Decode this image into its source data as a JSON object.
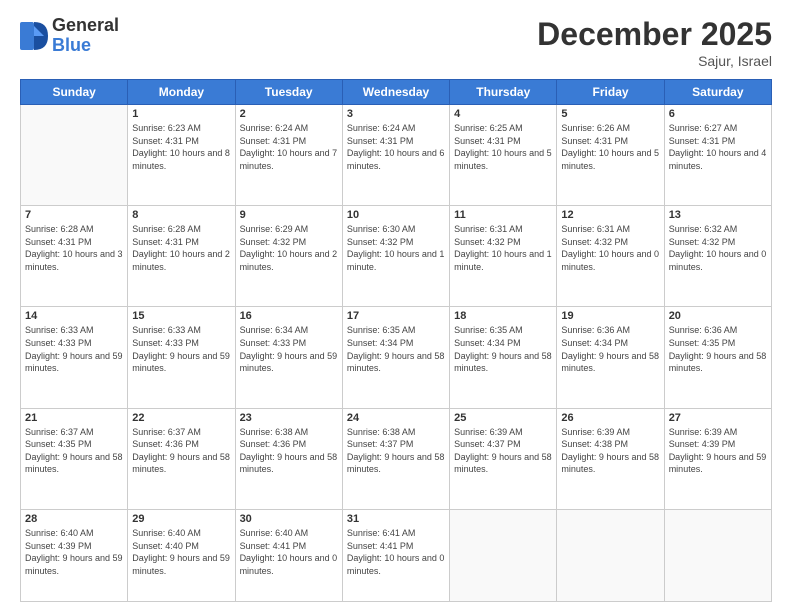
{
  "header": {
    "logo_general": "General",
    "logo_blue": "Blue",
    "title": "December 2025",
    "location": "Sajur, Israel"
  },
  "days_of_week": [
    "Sunday",
    "Monday",
    "Tuesday",
    "Wednesday",
    "Thursday",
    "Friday",
    "Saturday"
  ],
  "weeks": [
    [
      {
        "day": null,
        "info": null
      },
      {
        "day": "1",
        "sunrise": "6:23 AM",
        "sunset": "4:31 PM",
        "daylight": "10 hours and 8 minutes."
      },
      {
        "day": "2",
        "sunrise": "6:24 AM",
        "sunset": "4:31 PM",
        "daylight": "10 hours and 7 minutes."
      },
      {
        "day": "3",
        "sunrise": "6:24 AM",
        "sunset": "4:31 PM",
        "daylight": "10 hours and 6 minutes."
      },
      {
        "day": "4",
        "sunrise": "6:25 AM",
        "sunset": "4:31 PM",
        "daylight": "10 hours and 5 minutes."
      },
      {
        "day": "5",
        "sunrise": "6:26 AM",
        "sunset": "4:31 PM",
        "daylight": "10 hours and 5 minutes."
      },
      {
        "day": "6",
        "sunrise": "6:27 AM",
        "sunset": "4:31 PM",
        "daylight": "10 hours and 4 minutes."
      }
    ],
    [
      {
        "day": "7",
        "sunrise": "6:28 AM",
        "sunset": "4:31 PM",
        "daylight": "10 hours and 3 minutes."
      },
      {
        "day": "8",
        "sunrise": "6:28 AM",
        "sunset": "4:31 PM",
        "daylight": "10 hours and 2 minutes."
      },
      {
        "day": "9",
        "sunrise": "6:29 AM",
        "sunset": "4:32 PM",
        "daylight": "10 hours and 2 minutes."
      },
      {
        "day": "10",
        "sunrise": "6:30 AM",
        "sunset": "4:32 PM",
        "daylight": "10 hours and 1 minute."
      },
      {
        "day": "11",
        "sunrise": "6:31 AM",
        "sunset": "4:32 PM",
        "daylight": "10 hours and 1 minute."
      },
      {
        "day": "12",
        "sunrise": "6:31 AM",
        "sunset": "4:32 PM",
        "daylight": "10 hours and 0 minutes."
      },
      {
        "day": "13",
        "sunrise": "6:32 AM",
        "sunset": "4:32 PM",
        "daylight": "10 hours and 0 minutes."
      }
    ],
    [
      {
        "day": "14",
        "sunrise": "6:33 AM",
        "sunset": "4:33 PM",
        "daylight": "9 hours and 59 minutes."
      },
      {
        "day": "15",
        "sunrise": "6:33 AM",
        "sunset": "4:33 PM",
        "daylight": "9 hours and 59 minutes."
      },
      {
        "day": "16",
        "sunrise": "6:34 AM",
        "sunset": "4:33 PM",
        "daylight": "9 hours and 59 minutes."
      },
      {
        "day": "17",
        "sunrise": "6:35 AM",
        "sunset": "4:34 PM",
        "daylight": "9 hours and 58 minutes."
      },
      {
        "day": "18",
        "sunrise": "6:35 AM",
        "sunset": "4:34 PM",
        "daylight": "9 hours and 58 minutes."
      },
      {
        "day": "19",
        "sunrise": "6:36 AM",
        "sunset": "4:34 PM",
        "daylight": "9 hours and 58 minutes."
      },
      {
        "day": "20",
        "sunrise": "6:36 AM",
        "sunset": "4:35 PM",
        "daylight": "9 hours and 58 minutes."
      }
    ],
    [
      {
        "day": "21",
        "sunrise": "6:37 AM",
        "sunset": "4:35 PM",
        "daylight": "9 hours and 58 minutes."
      },
      {
        "day": "22",
        "sunrise": "6:37 AM",
        "sunset": "4:36 PM",
        "daylight": "9 hours and 58 minutes."
      },
      {
        "day": "23",
        "sunrise": "6:38 AM",
        "sunset": "4:36 PM",
        "daylight": "9 hours and 58 minutes."
      },
      {
        "day": "24",
        "sunrise": "6:38 AM",
        "sunset": "4:37 PM",
        "daylight": "9 hours and 58 minutes."
      },
      {
        "day": "25",
        "sunrise": "6:39 AM",
        "sunset": "4:37 PM",
        "daylight": "9 hours and 58 minutes."
      },
      {
        "day": "26",
        "sunrise": "6:39 AM",
        "sunset": "4:38 PM",
        "daylight": "9 hours and 58 minutes."
      },
      {
        "day": "27",
        "sunrise": "6:39 AM",
        "sunset": "4:39 PM",
        "daylight": "9 hours and 59 minutes."
      }
    ],
    [
      {
        "day": "28",
        "sunrise": "6:40 AM",
        "sunset": "4:39 PM",
        "daylight": "9 hours and 59 minutes."
      },
      {
        "day": "29",
        "sunrise": "6:40 AM",
        "sunset": "4:40 PM",
        "daylight": "9 hours and 59 minutes."
      },
      {
        "day": "30",
        "sunrise": "6:40 AM",
        "sunset": "4:41 PM",
        "daylight": "10 hours and 0 minutes."
      },
      {
        "day": "31",
        "sunrise": "6:41 AM",
        "sunset": "4:41 PM",
        "daylight": "10 hours and 0 minutes."
      },
      {
        "day": null,
        "info": null
      },
      {
        "day": null,
        "info": null
      },
      {
        "day": null,
        "info": null
      }
    ]
  ]
}
